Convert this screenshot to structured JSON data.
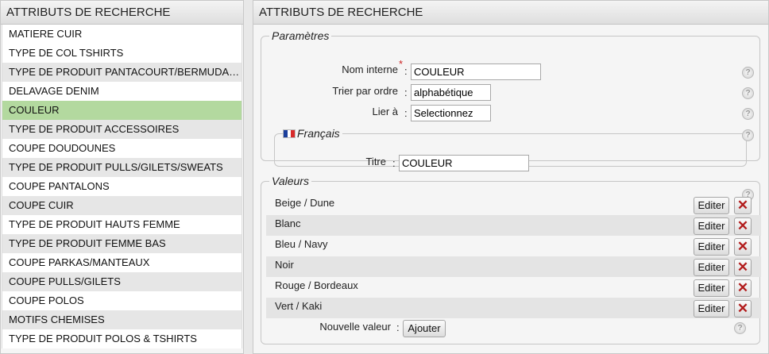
{
  "left_panel": {
    "title": "ATTRIBUTS DE RECHERCHE",
    "items": [
      "MATIERE CUIR",
      "TYPE DE COL TSHIRTS",
      "TYPE DE PRODUIT PANTACOURT/BERMUDA/…",
      "DELAVAGE DENIM",
      "COULEUR",
      "TYPE DE PRODUIT ACCESSOIRES",
      "COUPE DOUDOUNES",
      "TYPE DE PRODUIT PULLS/GILETS/SWEATS",
      "COUPE PANTALONS",
      "COUPE CUIR",
      "TYPE DE PRODUIT HAUTS FEMME",
      "TYPE DE PRODUIT FEMME BAS",
      "COUPE PARKAS/MANTEAUX",
      "COUPE PULLS/GILETS",
      "COUPE POLOS",
      "MOTIFS CHEMISES",
      "TYPE DE PRODUIT POLOS & TSHIRTS"
    ],
    "selected": "COULEUR"
  },
  "right_panel": {
    "title": "ATTRIBUTS DE RECHERCHE",
    "params": {
      "legend": "Paramètres",
      "nom_interne_label": "Nom interne",
      "required_mark": "*",
      "nom_interne_value": "COULEUR",
      "trier_label": "Trier par ordre",
      "trier_value": "alphabétique",
      "lier_label": "Lier à",
      "lier_value": "Selectionnez",
      "colon": ":"
    },
    "francais": {
      "legend": "Français",
      "titre_label": "Titre",
      "titre_value": "COULEUR"
    },
    "valeurs": {
      "legend": "Valeurs",
      "edit_label": "Editer",
      "delete_symbol": "✕",
      "items": [
        "Beige / Dune",
        "Blanc",
        "Bleu / Navy",
        "Noir",
        "Rouge / Bordeaux",
        "Vert / Kaki"
      ],
      "nouvelle_label": "Nouvelle valeur",
      "add_label": "Ajouter"
    },
    "help_symbol": "?"
  },
  "colors": {
    "selected_row": "#b3d99f",
    "delete_red": "#b21b1b",
    "required_red": "#cc2222"
  }
}
